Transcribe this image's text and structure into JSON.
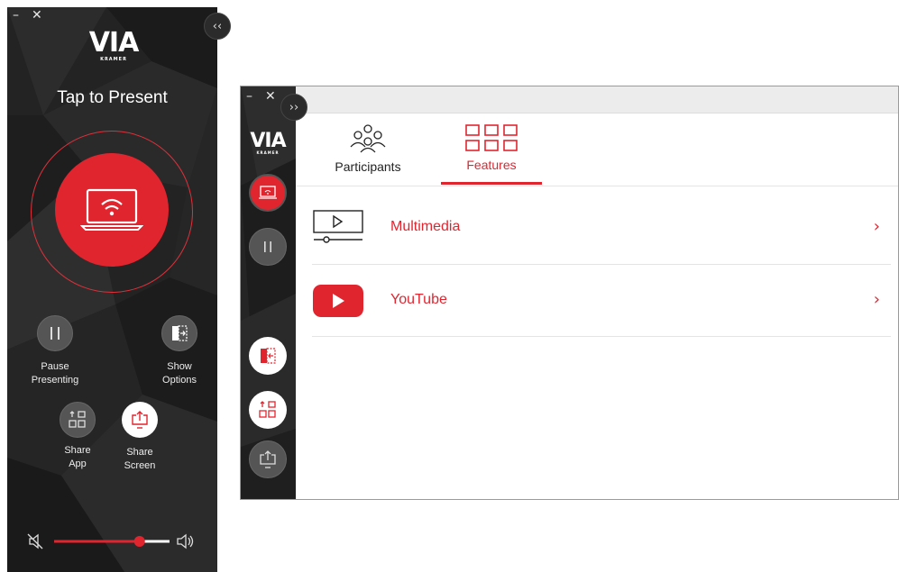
{
  "left_panel": {
    "window_controls": {
      "minimize": "–",
      "close": "✕"
    },
    "collapse_button": "‹‹",
    "logo": {
      "text": "VIA",
      "subtext": "KRAMER"
    },
    "headline": "Tap to Present",
    "present_button_icon": "laptop-wifi-icon",
    "actions": [
      {
        "label": "Pause\nPresenting",
        "icon": "pause-icon"
      },
      {
        "label": "Show\nOptions",
        "icon": "show-options-icon"
      },
      {
        "label": "Share\nApp",
        "icon": "share-app-icon"
      },
      {
        "label": "Share\nScreen",
        "icon": "share-screen-icon"
      }
    ],
    "volume": {
      "level": 0.74,
      "mute_icon": "mute-icon",
      "speaker_icon": "speaker-icon"
    }
  },
  "right_panel": {
    "window_controls": {
      "minimize": "–",
      "close": "✕"
    },
    "expand_button": "››",
    "logo": {
      "text": "VIA",
      "subtext": "KRAMER"
    },
    "sidebar_icons": [
      "present-icon",
      "pause-icon",
      "show-options-icon",
      "share-app-icon",
      "share-screen-icon"
    ],
    "tabs": [
      {
        "label": "Participants",
        "icon": "participants-icon",
        "active": false
      },
      {
        "label": "Features",
        "icon": "features-grid-icon",
        "active": true
      }
    ],
    "features": [
      {
        "label": "Multimedia",
        "icon": "multimedia-icon",
        "chevron": "›"
      },
      {
        "label": "YouTube",
        "icon": "youtube-icon",
        "chevron": "›"
      }
    ]
  },
  "colors": {
    "accent": "#e1252f",
    "dark": "#222222"
  }
}
